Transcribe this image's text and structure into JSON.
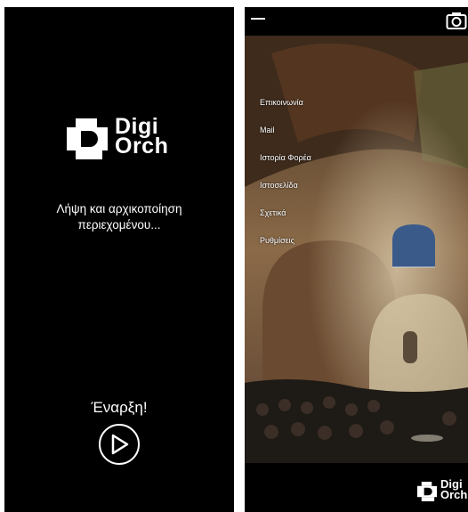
{
  "splash": {
    "logo_line1": "Digi",
    "logo_line2": "Orch",
    "loading_line1": "Λήψη και αρχικοποίηση",
    "loading_line2": "περιεχομένου...",
    "start_label": "Έναρξη!",
    "play_icon": "play-circle-icon"
  },
  "home": {
    "icons": {
      "menu": "menu-icon",
      "camera": "camera-icon"
    },
    "menu_items": [
      {
        "label": "Επικοινωνία"
      },
      {
        "label": "Mail"
      },
      {
        "label": "Ιστορία Φορέα"
      },
      {
        "label": "Ιστοσελίδα"
      },
      {
        "label": "Σχετικά"
      },
      {
        "label": "Ρυθμίσεις"
      }
    ],
    "logo_line1": "Digi",
    "logo_line2": "Orch"
  },
  "colors": {
    "background": "#000000",
    "text": "#ffffff"
  }
}
